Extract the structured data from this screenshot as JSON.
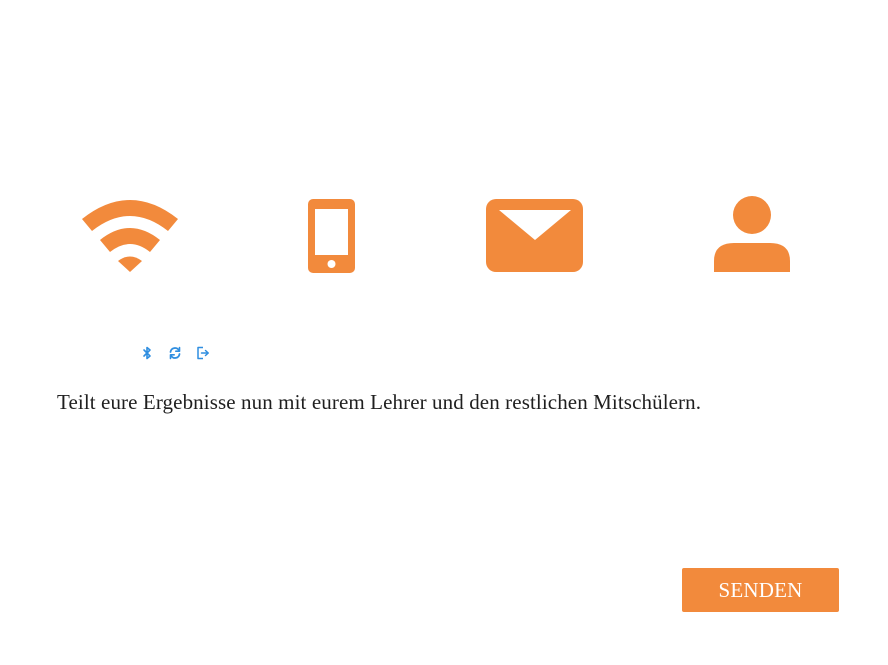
{
  "colors": {
    "accent": "#f28a3c",
    "small_icon": "#2f8ee0",
    "text": "#1f1f1f",
    "button_text": "#ffffff"
  },
  "share_options": [
    {
      "icon": "wifi-icon"
    },
    {
      "icon": "smartphone-icon"
    },
    {
      "icon": "envelope-icon"
    },
    {
      "icon": "user-icon"
    }
  ],
  "small_icons": [
    "bluetooth-icon",
    "sync-icon",
    "sign-out-icon"
  ],
  "message": "Teilt eure Ergebnisse nun mit eurem Lehrer und den restlichen Mitschülern.",
  "send_button_label": "SENDEN"
}
